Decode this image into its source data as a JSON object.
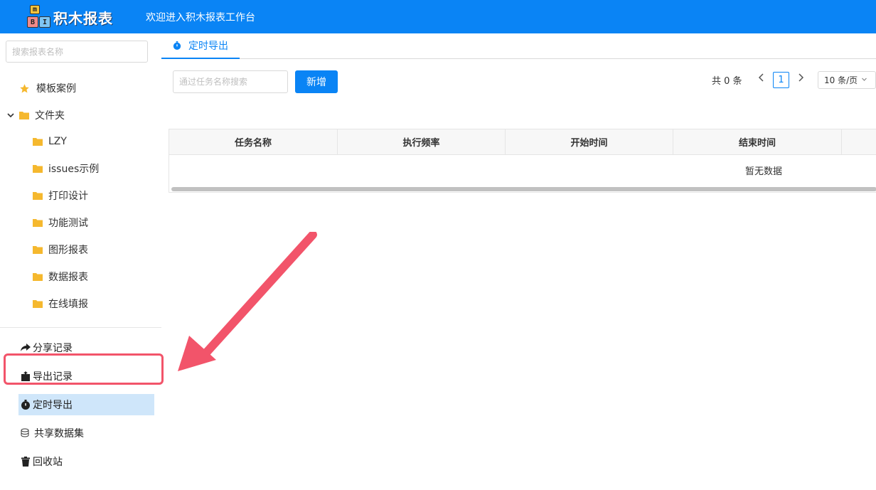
{
  "header": {
    "logo_letters": [
      "m",
      "B",
      "I"
    ],
    "brand": "积木报表",
    "welcome": "欢迎进入积木报表工作台",
    "color": "#0a84f5"
  },
  "sidebar": {
    "search_placeholder": "搜索报表名称",
    "templates": "模板案例",
    "folder": "文件夹",
    "folders": [
      "LZY",
      "issues示例",
      "打印设计",
      "功能测试",
      "图形报表",
      "数据报表",
      "在线填报"
    ],
    "menu": [
      {
        "label": "分享记录",
        "icon": "share-icon"
      },
      {
        "label": "导出记录",
        "icon": "export-icon"
      },
      {
        "label": "定时导出",
        "icon": "timer-icon",
        "active": true
      },
      {
        "label": "共享数据集",
        "icon": "database-icon"
      },
      {
        "label": "回收站",
        "icon": "trash-icon"
      }
    ]
  },
  "tabs": {
    "active": "定时导出"
  },
  "toolbar": {
    "search_placeholder": "通过任务名称搜索",
    "add_label": "新增"
  },
  "pagination": {
    "total": "共 0 条",
    "current_page": "1",
    "page_size": "10 条/页"
  },
  "table": {
    "columns": [
      "任务名称",
      "执行频率",
      "开始时间",
      "结束时间"
    ],
    "empty_text": "暂无数据"
  },
  "annotation": {
    "highlight_color": "#f2546a"
  }
}
